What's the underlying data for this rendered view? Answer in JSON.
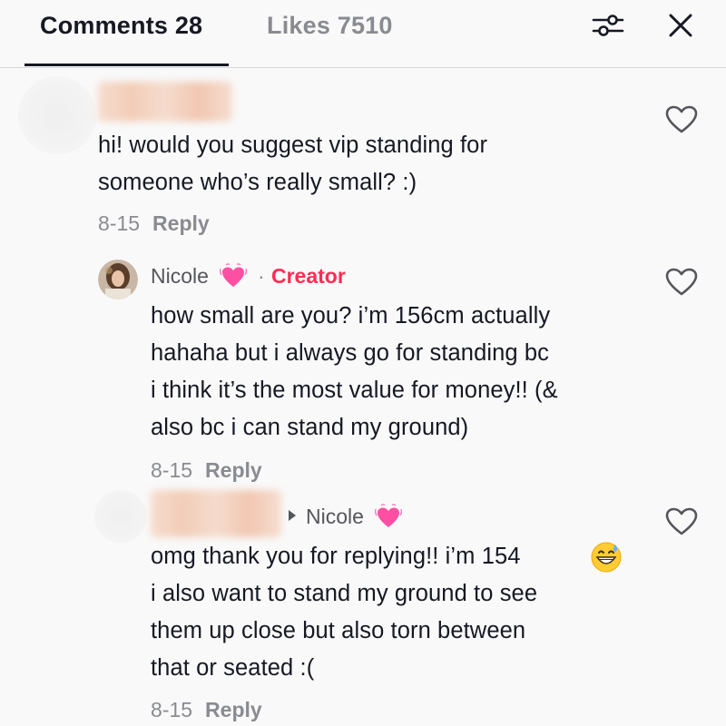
{
  "header": {
    "comments_tab": "Comments 28",
    "likes_tab": "Likes 7510",
    "filter_icon": "sliders-icon",
    "close_icon": "close-icon"
  },
  "comments": [
    {
      "author": "",
      "text": "hi! would you suggest vip standing for\nsomeone who’s really small? :)",
      "date": "8-15",
      "reply_label": "Reply"
    },
    {
      "author": "Nicole",
      "author_emoji": "💓",
      "tag_separator": "·",
      "tag": "Creator",
      "text": "how small are you? i’m 156cm actually\nhahaha but i always go for standing bc\ni think it’s the most value for money!! (&\nalso bc i can stand my ground)",
      "date": "8-15",
      "reply_label": "Reply"
    },
    {
      "author": "",
      "reply_to": "Nicole",
      "reply_to_emoji": "💓",
      "text_line1": "omg thank you for replying!! i’m 154",
      "text_rest": "i also want to stand my ground to see\nthem up close but also torn between\nthat or seated :(",
      "date": "8-15",
      "reply_label": "Reply"
    }
  ],
  "colors": {
    "accent": "#fe2c55",
    "text_primary": "#161823",
    "text_secondary": "#8a8b91",
    "background": "#f9f9f9"
  }
}
